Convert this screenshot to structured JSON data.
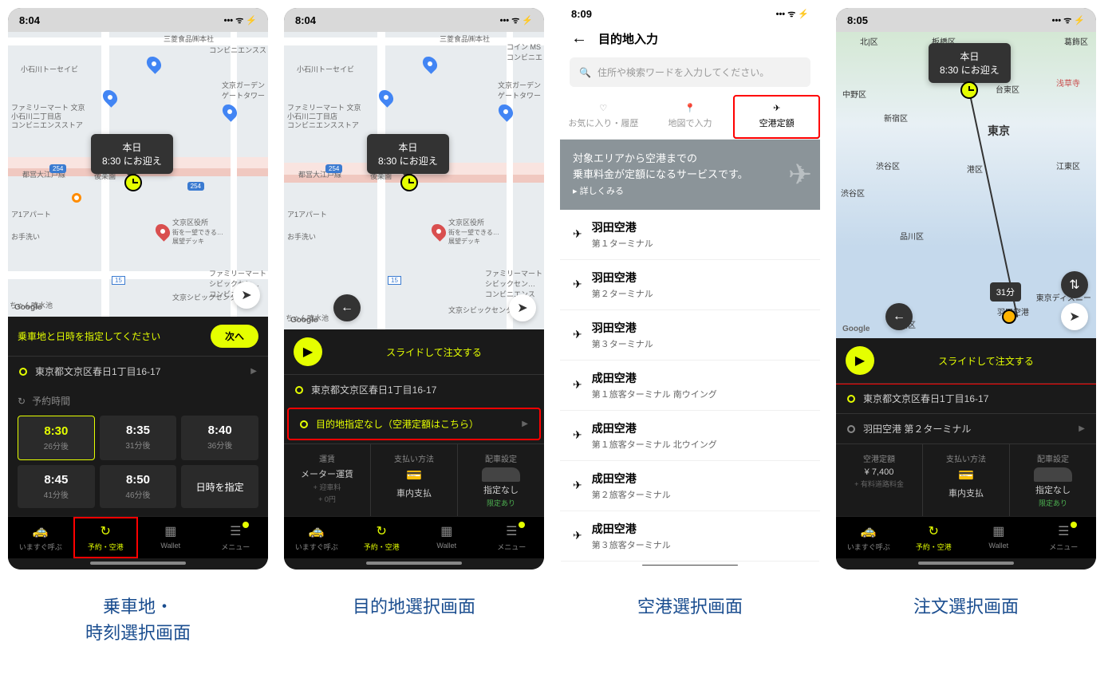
{
  "status": {
    "time1": "8:04",
    "time2": "8:04",
    "time3": "8:09",
    "time4": "8:05",
    "icons": "••• ᯤ ⚡"
  },
  "tooltip": {
    "line1": "本日",
    "line2": "8:30 にお迎え"
  },
  "map": {
    "mitsubishi": "三菱食品㈱本社",
    "conv": "コンビニエンスス",
    "koishikawa": "小石川トーセイビ",
    "famCombo": "ファミリーマート 文京\n小石川二丁目店\nコンビニエンスストア",
    "garden": "文京ガーデン\nゲートタワー",
    "oedo": "都営大江戸線",
    "korakuen": "後楽園",
    "apart": "ア1アパート",
    "otearai": "お手洗い",
    "ward": "文京区役所",
    "wardSub": "街を一望できる…\n展望デッキ",
    "civic": "ファミリーマート\nシビックセン…\nコンビニエンス",
    "civicCenter": "文京シビックセンター",
    "funsui": "ちゃん噴水池",
    "google": "Google",
    "r254": "254",
    "r15": "15",
    "kitaM": "北|区",
    "itabashi": "板橋区",
    "nakano": "中野区",
    "shinjuku": "新宿区",
    "shibuya": "渋谷区",
    "minato": "港区",
    "shinagawa": "品川区",
    "ota": "大田区",
    "taito": "台東区",
    "koto": "江東区",
    "katsushika": "葛飾区",
    "tokyo": "東京",
    "asakusa": "浅草寺",
    "disney": "東京ディズニー",
    "haneda": "羽田空港",
    "duration": "31分",
    "convMs": "コイン MS\nコンビニエ"
  },
  "panel1": {
    "instruction": "乗車地と日時を指定してください",
    "nextBtn": "次へ",
    "pickup": "東京都文京区春日1丁目16-17",
    "reserveLabel": "予約時間",
    "times": [
      {
        "t": "8:30",
        "sub": "26分後",
        "active": true
      },
      {
        "t": "8:35",
        "sub": "31分後"
      },
      {
        "t": "8:40",
        "sub": "36分後"
      },
      {
        "t": "8:45",
        "sub": "41分後"
      },
      {
        "t": "8:50",
        "sub": "46分後"
      }
    ],
    "specify": "日時を指定"
  },
  "panel2": {
    "slideText": "スライドして注文する",
    "pickup": "東京都文京区春日1丁目16-17",
    "dest": "目的地指定なし（空港定額はこちら）",
    "details": {
      "c1": {
        "lbl": "運賃",
        "val": "メーター運賃",
        "sub1": "+ 迎車料",
        "sub2": "+ 0円"
      },
      "c2": {
        "lbl": "支払い方法",
        "val": "車内支払"
      },
      "c3": {
        "lbl": "配車設定",
        "val": "指定なし",
        "sub": "限定あり"
      }
    }
  },
  "panel3": {
    "title": "目的地入力",
    "searchPh": "住所や検索ワードを入力してください。",
    "tabs": {
      "fav": "お気に入り・履歴",
      "map": "地図で入力",
      "airport": "空港定額"
    },
    "promo": {
      "l1": "対象エリアから空港までの",
      "l2": "乗車料金が定額になるサービスです。",
      "more": "▸ 詳しくみる"
    },
    "airports": [
      {
        "name": "羽田空港",
        "term": "第１ターミナル"
      },
      {
        "name": "羽田空港",
        "term": "第２ターミナル"
      },
      {
        "name": "羽田空港",
        "term": "第３ターミナル"
      },
      {
        "name": "成田空港",
        "term": "第１旅客ターミナル 南ウイング"
      },
      {
        "name": "成田空港",
        "term": "第１旅客ターミナル 北ウイング"
      },
      {
        "name": "成田空港",
        "term": "第２旅客ターミナル"
      },
      {
        "name": "成田空港",
        "term": "第３旅客ターミナル"
      }
    ]
  },
  "panel4": {
    "slideText": "スライドして注文する",
    "pickup": "東京都文京区春日1丁目16-17",
    "dest": "羽田空港 第２ターミナル",
    "details": {
      "c1": {
        "lbl": "空港定額",
        "val": "¥ 7,400",
        "sub": "+ 有料道路料金"
      },
      "c2": {
        "lbl": "支払い方法",
        "val": "車内支払"
      },
      "c3": {
        "lbl": "配車設定",
        "val": "指定なし",
        "sub": "限定あり"
      }
    }
  },
  "tabs": {
    "now": "いますぐ呼ぶ",
    "reserve": "予約・空港",
    "wallet": "Wallet",
    "menu": "メニュー"
  },
  "captions": {
    "c1": "乗車地・\n時刻選択画面",
    "c2": "目的地選択画面",
    "c3": "空港選択画面",
    "c4": "注文選択画面"
  }
}
